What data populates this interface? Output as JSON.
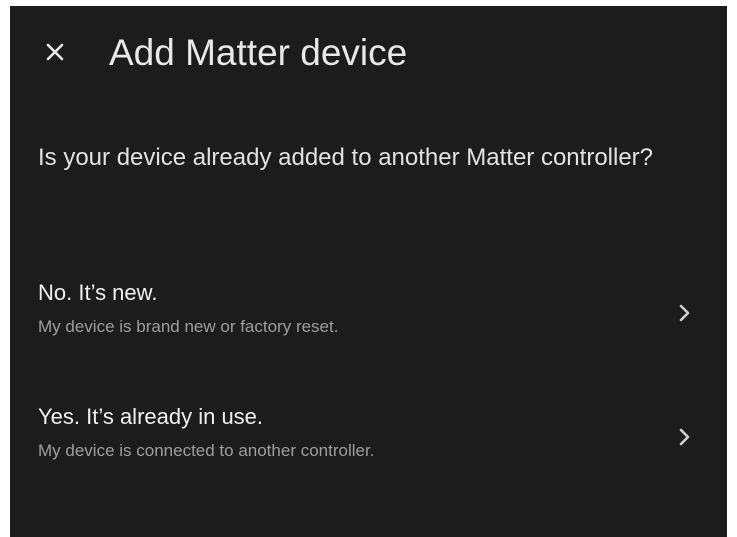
{
  "dialog": {
    "title": "Add Matter device",
    "close_icon": "close-icon",
    "question": "Is your device already added to another Matter controller?"
  },
  "options": [
    {
      "title": "No. It’s new.",
      "subtitle": "My device is brand new or factory reset.",
      "icon": "chevron-right-icon"
    },
    {
      "title": "Yes. It’s already in use.",
      "subtitle": "My device is connected to another controller.",
      "icon": "chevron-right-icon"
    }
  ],
  "colors": {
    "background": "#1c1c1c",
    "primary_text": "#e8e8e8",
    "secondary_text": "#9e9e9e"
  }
}
